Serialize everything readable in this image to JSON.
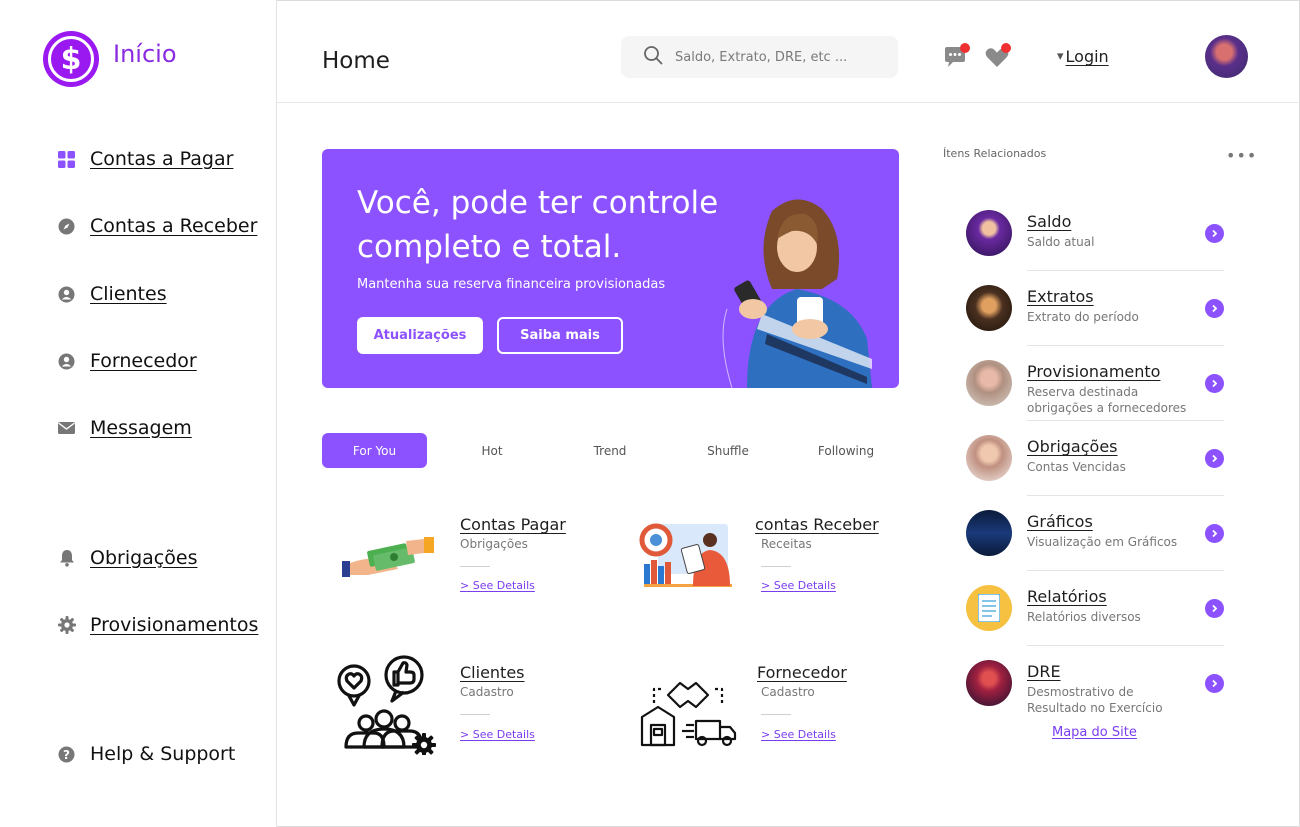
{
  "app": {
    "brand": "Início"
  },
  "sidebar": {
    "items": [
      {
        "label": "Contas a Pagar",
        "icon": "grid-icon"
      },
      {
        "label": "Contas a Receber",
        "icon": "compass-icon"
      },
      {
        "label": "Clientes",
        "icon": "user-circle-icon"
      },
      {
        "label": "Fornecedor",
        "icon": "user-circle-icon"
      },
      {
        "label": "Messagem",
        "icon": "mail-icon"
      },
      {
        "label": "Obrigações",
        "icon": "bell-icon"
      },
      {
        "label": "Provisionamentos",
        "icon": "gear-icon"
      },
      {
        "label": "Help & Support",
        "icon": "help-icon"
      }
    ]
  },
  "header": {
    "title": "Home",
    "search_placeholder": "Saldo, Extrato, DRE, etc ...",
    "login_label": "Login",
    "login_caret": "▾"
  },
  "hero": {
    "title": "Você, pode ter controle completo e total.",
    "subtitle": "Mantenha sua reserva financeira provisionadas",
    "primary_button": "Atualizações",
    "secondary_button": "Saiba mais",
    "bg_color": "#8c52ff"
  },
  "tabs": [
    {
      "label": "For You",
      "active": true
    },
    {
      "label": "Hot",
      "active": false
    },
    {
      "label": "Trend",
      "active": false
    },
    {
      "label": "Shuffle",
      "active": false
    },
    {
      "label": "Following",
      "active": false
    }
  ],
  "cards": [
    {
      "title": "Contas Pagar",
      "subtitle": "Obrigações",
      "link": "> See Details"
    },
    {
      "title": "contas Receber",
      "subtitle": "Receitas",
      "link": "> See Details"
    },
    {
      "title": "Clientes",
      "subtitle": "Cadastro",
      "link": "> See Details"
    },
    {
      "title": "Fornecedor",
      "subtitle": "Cadastro",
      "link": "> See Details"
    }
  ],
  "related": {
    "title": "Ítens Relacionados",
    "more": "•••",
    "items": [
      {
        "name": "Saldo",
        "desc": "Saldo atual"
      },
      {
        "name": "Extratos",
        "desc": "Extrato do período"
      },
      {
        "name": "Provisionamento",
        "desc": "Reserva destinada obrigações a fornecedores"
      },
      {
        "name": "Obrigações",
        "desc": "Contas Vencidas"
      },
      {
        "name": "Gráficos",
        "desc": "Visualização em Gráficos"
      },
      {
        "name": "Relatórios",
        "desc": "Relatórios diversos"
      },
      {
        "name": "DRE",
        "desc": "Desmostrativo de Resultado no Exercício"
      }
    ],
    "sitemap": "Mapa do Site"
  },
  "colors": {
    "accent": "#8c52ff",
    "brand": "#9a19f0",
    "notification": "#f03030"
  }
}
